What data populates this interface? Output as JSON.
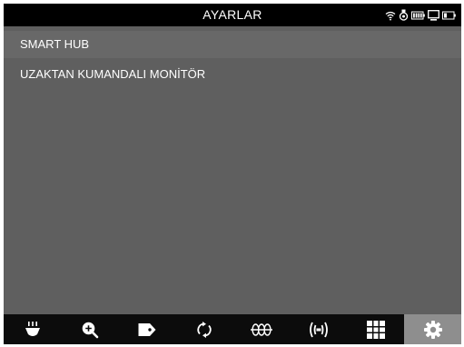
{
  "window": {
    "title": "AYARLAR"
  },
  "menu": {
    "items": [
      {
        "label": "SMART HUB",
        "selected": true
      },
      {
        "label": "UZAKTAN KUMANDALI MONİTÖR",
        "selected": false
      }
    ]
  },
  "status_icons": [
    "wifi-icon",
    "camera-icon",
    "battery-icon",
    "monitor-icon",
    "battery-low-icon"
  ],
  "toolbar": {
    "tools": [
      {
        "icon": "light-icon",
        "active": false
      },
      {
        "icon": "zoom-in-icon",
        "active": false
      },
      {
        "icon": "tag-icon",
        "active": false
      },
      {
        "icon": "rotate-icon",
        "active": false
      },
      {
        "icon": "wave-icon",
        "active": false
      },
      {
        "icon": "signal-icon",
        "active": false
      },
      {
        "icon": "grid-icon",
        "active": false
      },
      {
        "icon": "settings-icon",
        "active": true
      }
    ]
  },
  "colors": {
    "background": "#5f5f5f",
    "bar": "#000000",
    "selected_row": "#686868",
    "active_tool": "#8e8e8e",
    "text": "#ffffff"
  }
}
